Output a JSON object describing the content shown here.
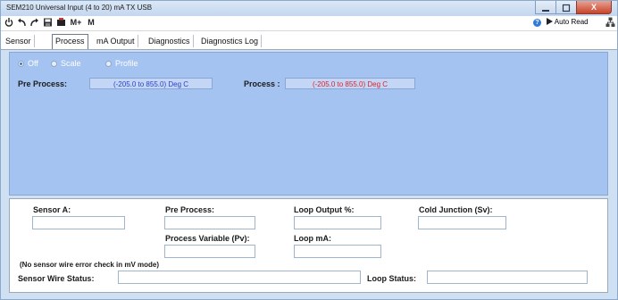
{
  "window": {
    "title": "SEM210 Universal Input (4 to 20) mA TX USB",
    "controls": [
      "minimize",
      "maximize",
      "close"
    ],
    "close_glyph": "X"
  },
  "toolbar": {
    "items": [
      "power-icon",
      "back-icon",
      "forward-icon",
      "save-icon",
      "record-icon"
    ],
    "m_plus": "M+",
    "m": "M",
    "help_glyph": "?",
    "auto_read": "Auto Read",
    "auto_read_icon": "play-icon",
    "end_icon": "network-icon"
  },
  "tabs": [
    {
      "label": "Sensor",
      "active": false
    },
    {
      "label": "Process",
      "active": true
    },
    {
      "label": "mA Output",
      "active": false
    },
    {
      "label": "Diagnostics",
      "active": false
    },
    {
      "label": "Diagnostics Log",
      "active": false
    }
  ],
  "process_panel": {
    "modes": [
      {
        "label": "Off",
        "selected": true
      },
      {
        "label": "Scale",
        "selected": false
      },
      {
        "label": "Profile",
        "selected": false
      }
    ],
    "pre_process_label": "Pre Process:",
    "pre_process_range": "(-205.0 to 855.0) Deg C",
    "process_label": "Process :",
    "process_range": "(-205.0 to 855.0) Deg C",
    "colors": {
      "pre_range_text": "#2a3fd0",
      "process_range_text": "#e0202a",
      "panel": "#a5c3f1"
    }
  },
  "readings": {
    "sensor_a": {
      "label": "Sensor A:",
      "value": ""
    },
    "pre_process": {
      "label": "Pre Process:",
      "value": ""
    },
    "loop_output": {
      "label": "Loop Output %:",
      "value": ""
    },
    "cold_junction": {
      "label": "Cold Junction (Sv):",
      "value": ""
    },
    "process_variable": {
      "label": "Process Variable (Pv):",
      "value": ""
    },
    "loop_ma": {
      "label": "Loop mA:",
      "value": ""
    },
    "note": "(No sensor wire error check in mV mode)",
    "sensor_wire_status": {
      "label": "Sensor Wire Status:",
      "value": ""
    },
    "loop_status": {
      "label": "Loop Status:",
      "value": ""
    }
  }
}
